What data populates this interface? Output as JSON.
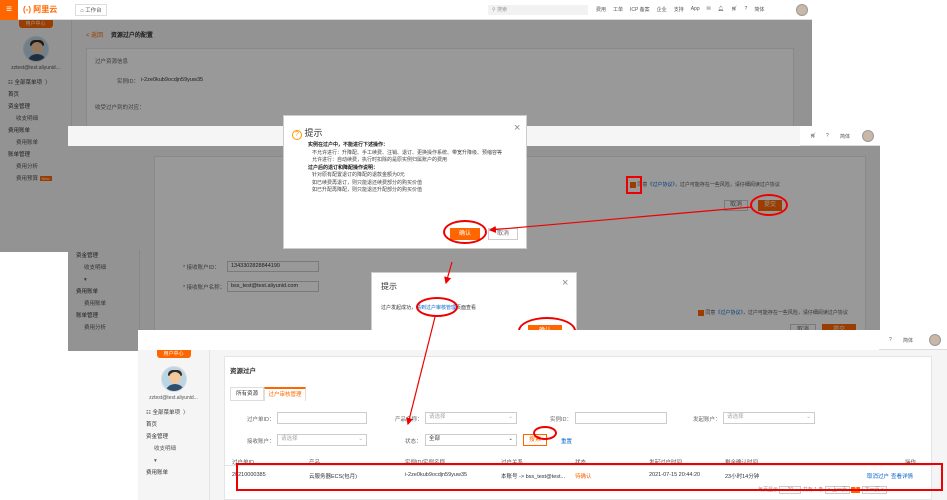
{
  "topbar": {
    "logo": "(-) 阿里云",
    "workbench": "工作台",
    "search_placeholder": "搜索",
    "links": [
      "费用",
      "工单",
      "ICP 备案",
      "企业",
      "支持",
      "App"
    ],
    "lang": "简体"
  },
  "sidebar": {
    "promo": "用户中心",
    "email": "zztest@test.aliyunid...",
    "all_menu": "全部菜单项",
    "items": [
      "首页",
      "资金管理",
      "收支明细",
      "费用账单",
      "费用账单",
      "账单管理",
      "费用分析",
      "费用预算"
    ],
    "new_badge": "New",
    "items_b": [
      "资金管理",
      "收支明细",
      "费用账单",
      "费用账单",
      "账单管理",
      "费用分析"
    ]
  },
  "page1": {
    "back": "< 返回",
    "title": "资源过户的配置",
    "section_resource": "过户资源信息",
    "instance_label": "实例ID：",
    "instance_value": "i-2ze0kub9ocdjn59yuw35",
    "section_target": "收受过户到的对应：",
    "receiver_id_label": "* 接收账户ID：",
    "receiver_id_value": "1343302828844190",
    "receiver_name_label": "* 接收账户名称：",
    "receiver_name_value": "bss_test@test.aliyunid.com"
  },
  "page2": {
    "agree_prefix": "同意",
    "agree_link": "《过户协议》",
    "agree_suffix": "，过户可能存在一些风险，请仔细阅读过户协议",
    "cancel": "取消",
    "submit": "提交"
  },
  "dialog1": {
    "title": "提示",
    "heading1": "实例在过户中，不能进行下述操作：",
    "lines1": [
      "不允许进行：升降配、手工续费、注销、退订、更换操作系统、带宽升降级、预缩容等",
      "允许进行：自动续费，执行时扣除的是原实例归属账户的费用"
    ],
    "heading2": "过户后的退订和降配操作说明：",
    "lines2": [
      "针对原有配置退订的降配的退款金额为0元",
      "如已续费再退订，则只能退还续费部分的购买价值",
      "如已升配再降配，则只能退还升配部分的购买价值"
    ],
    "confirm": "确认",
    "cancel": "取消"
  },
  "dialog2": {
    "title": "提示",
    "msg_prefix": "过户发起成功，",
    "msg_link": "请到过户审核管理",
    "msg_suffix": "页面查看",
    "confirm": "确认"
  },
  "page3": {
    "title": "资源过户",
    "tabs": [
      "所有资源",
      "过户审核管理"
    ],
    "filter_labels": [
      "过户单ID：",
      "产品名称：",
      "实例ID：",
      "发起账户：",
      "接收账户：",
      "状态："
    ],
    "select_placeholder": "请选择",
    "status_value": "全部",
    "search_btn": "搜索",
    "reset_btn": "重置",
    "headers": [
      "过户单ID",
      "产品",
      "实例ID/实例名称",
      "过户关系",
      "状态",
      "发起过户时间",
      "剩余确认时间",
      "操作"
    ],
    "row": {
      "id": "20210000385",
      "product": "云服务器ECS(包月)",
      "instance": "i-2ze0kub9ocdjn59yuw35",
      "relation": "本账号 -> bss_test@test...",
      "status": "待确认",
      "time": "2021-07-15 20:44:20",
      "remaining": "23小时14分钟",
      "op1": "取消过户",
      "op2": "查看详情"
    },
    "pager": {
      "per_page_label": "每页显示",
      "per_page": "20",
      "total": "共有 1 条",
      "prev": "< 上一页",
      "page": "1",
      "next": "下一页 >"
    }
  },
  "colors": {
    "accent": "#ff6a00",
    "highlight": "#e00000",
    "link": "#0066cc"
  }
}
